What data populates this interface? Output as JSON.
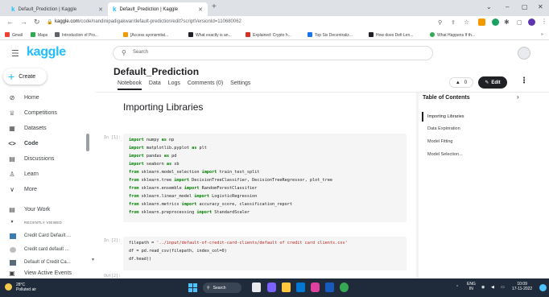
{
  "browser": {
    "tabs": [
      {
        "label": "Default_Prediction | Kaggle",
        "icon": "kaggle-k"
      },
      {
        "label": "Default_Prediction | Kaggle",
        "icon": "kaggle-k"
      }
    ],
    "new_tab": "+",
    "url_domain": "kaggle.com",
    "url_path": "/code/nandinipadigakwar/default-prediction/edit?scriptVersionId=110680062",
    "bookmarks": [
      {
        "label": "Gmail",
        "color": "#ea4335"
      },
      {
        "label": "Maps",
        "color": "#34a853"
      },
      {
        "label": "Introduction of Pro...",
        "color": "#5f6368"
      },
      {
        "label": "[Access ayonsmitat...",
        "color": "#f29900"
      },
      {
        "label": "What exactly is an...",
        "color": "#202124"
      },
      {
        "label": "Explained: Crypto h...",
        "color": "#d93025"
      },
      {
        "label": "Top Six Decentraliz...",
        "color": "#1a73e8"
      },
      {
        "label": "How does Defi Len...",
        "color": "#202124"
      },
      {
        "label": "What Happens If th...",
        "color": "#34a853"
      }
    ],
    "window_controls": [
      "⌄",
      "–",
      "▢",
      "✕"
    ]
  },
  "kaggle": {
    "logo": "kaggle",
    "search_placeholder": "Search",
    "create_label": "Create",
    "nav": [
      {
        "label": "Home",
        "icon": "home-icon",
        "glyph": "⊘"
      },
      {
        "label": "Competitions",
        "icon": "trophy-icon",
        "glyph": "♕"
      },
      {
        "label": "Datasets",
        "icon": "table-icon",
        "glyph": "▦"
      },
      {
        "label": "Code",
        "icon": "code-icon",
        "glyph": "<>"
      },
      {
        "label": "Discussions",
        "icon": "discussion-icon",
        "glyph": "▤"
      },
      {
        "label": "Learn",
        "icon": "learn-icon",
        "glyph": "♙"
      },
      {
        "label": "More",
        "icon": "chevron-down-icon",
        "glyph": "∨"
      }
    ],
    "your_work": "Your Work",
    "recently_viewed_label": "RECENTLY VIEWED",
    "recent": [
      "Credit Card Default ...",
      "Credit card default ...",
      "Default of Credit Ca..."
    ],
    "view_active_events": "View Active Events"
  },
  "notebook": {
    "title": "Default_Prediction",
    "tabs": [
      "Notebook",
      "Data",
      "Logs",
      "Comments (0)",
      "Settings"
    ],
    "vote_count": "0",
    "edit_label": "Edit",
    "heading": "Importing Libraries",
    "cell1_prompt": "In [1]:",
    "cell1_code": [
      "import numpy as np",
      "import matplotlib.pyplot as plt",
      "import pandas as pd",
      "import seaborn as sb",
      "from sklearn.model_selection import train_test_split",
      "from sklearn.tree import DecisionTreeClassifier, DecisionTreeRegressor, plot_tree",
      "from sklearn.ensemble import RandomForestClassifier",
      "from sklearn.linear_model import LogisticRegression",
      "from sklearn.metrics import accuracy_score, classification_report",
      "from sklearn.preprocessing import StandardScaler"
    ],
    "cell2_prompt": "In [2]:",
    "cell2_code": [
      "filepath = '../input/default-of-credit-card-clients/default of credit card clients.csv'",
      "df = pd.read_csv(filepath, index_col=0)",
      "df.head()"
    ],
    "out_prompt": "Out[2]:"
  },
  "toc": {
    "title": "Table of Contents",
    "items": [
      "Importing Libraries",
      "Data Exploration",
      "Model Fitting",
      "Model Selection..."
    ]
  },
  "taskbar": {
    "weather_temp": "28°C",
    "weather_desc": "Polluted air",
    "search_label": "Search",
    "lang_top": "ENG",
    "lang_bottom": "IN",
    "time": "10:09",
    "date": "17-11-2022"
  }
}
